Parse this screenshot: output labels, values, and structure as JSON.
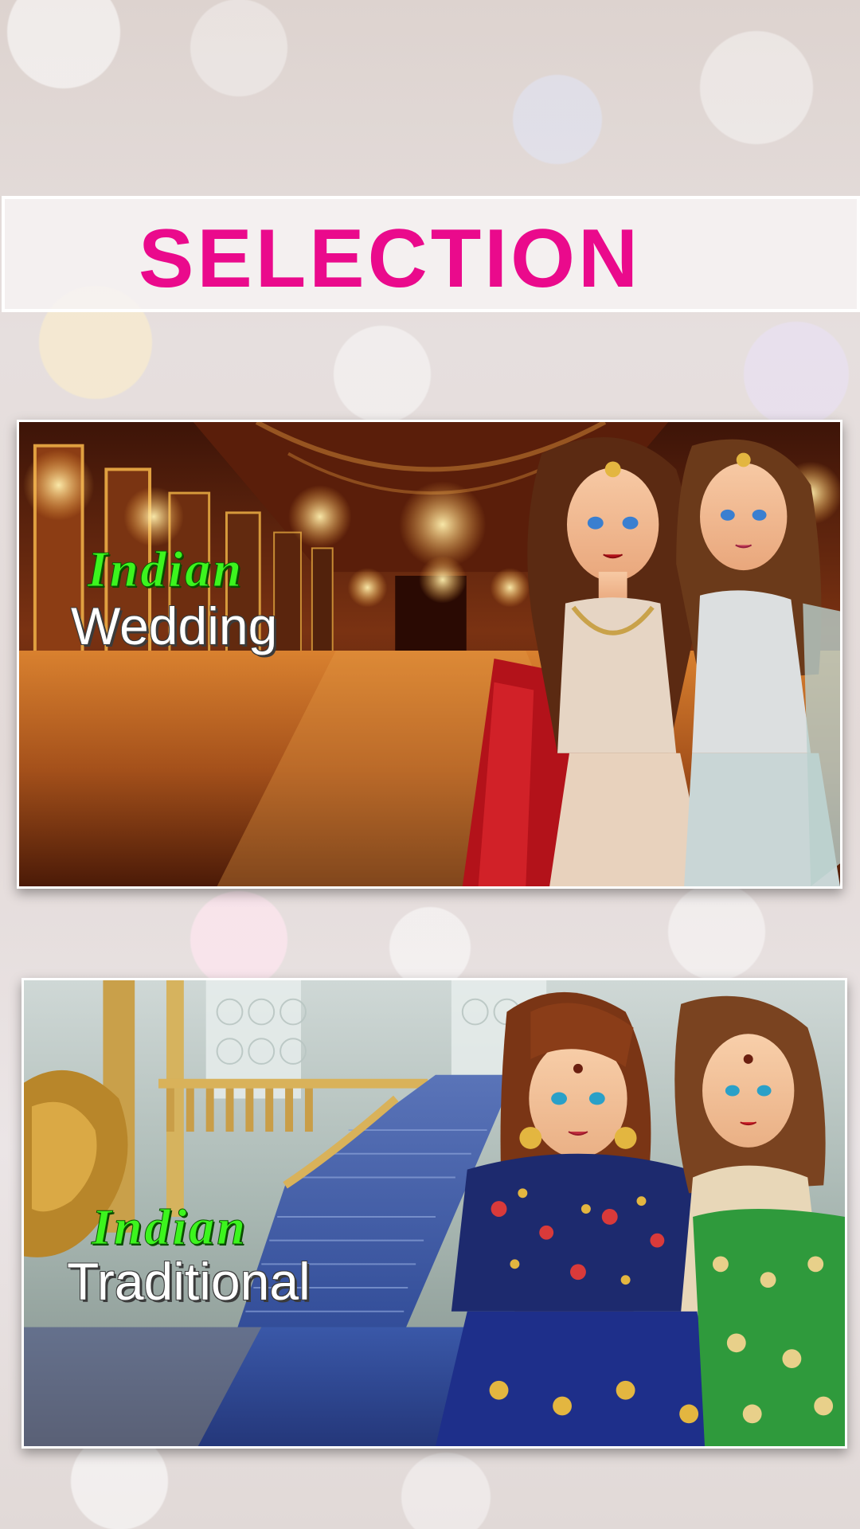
{
  "header": {
    "title": "SELECTION"
  },
  "options": [
    {
      "id": "wedding",
      "tag": "Indian",
      "label": "Wedding"
    },
    {
      "id": "traditional",
      "tag": "Indian",
      "label": "Traditional"
    }
  ],
  "colors": {
    "title": "#ea0a8c",
    "tag": "#3cf51e",
    "label": "#ffffff"
  }
}
